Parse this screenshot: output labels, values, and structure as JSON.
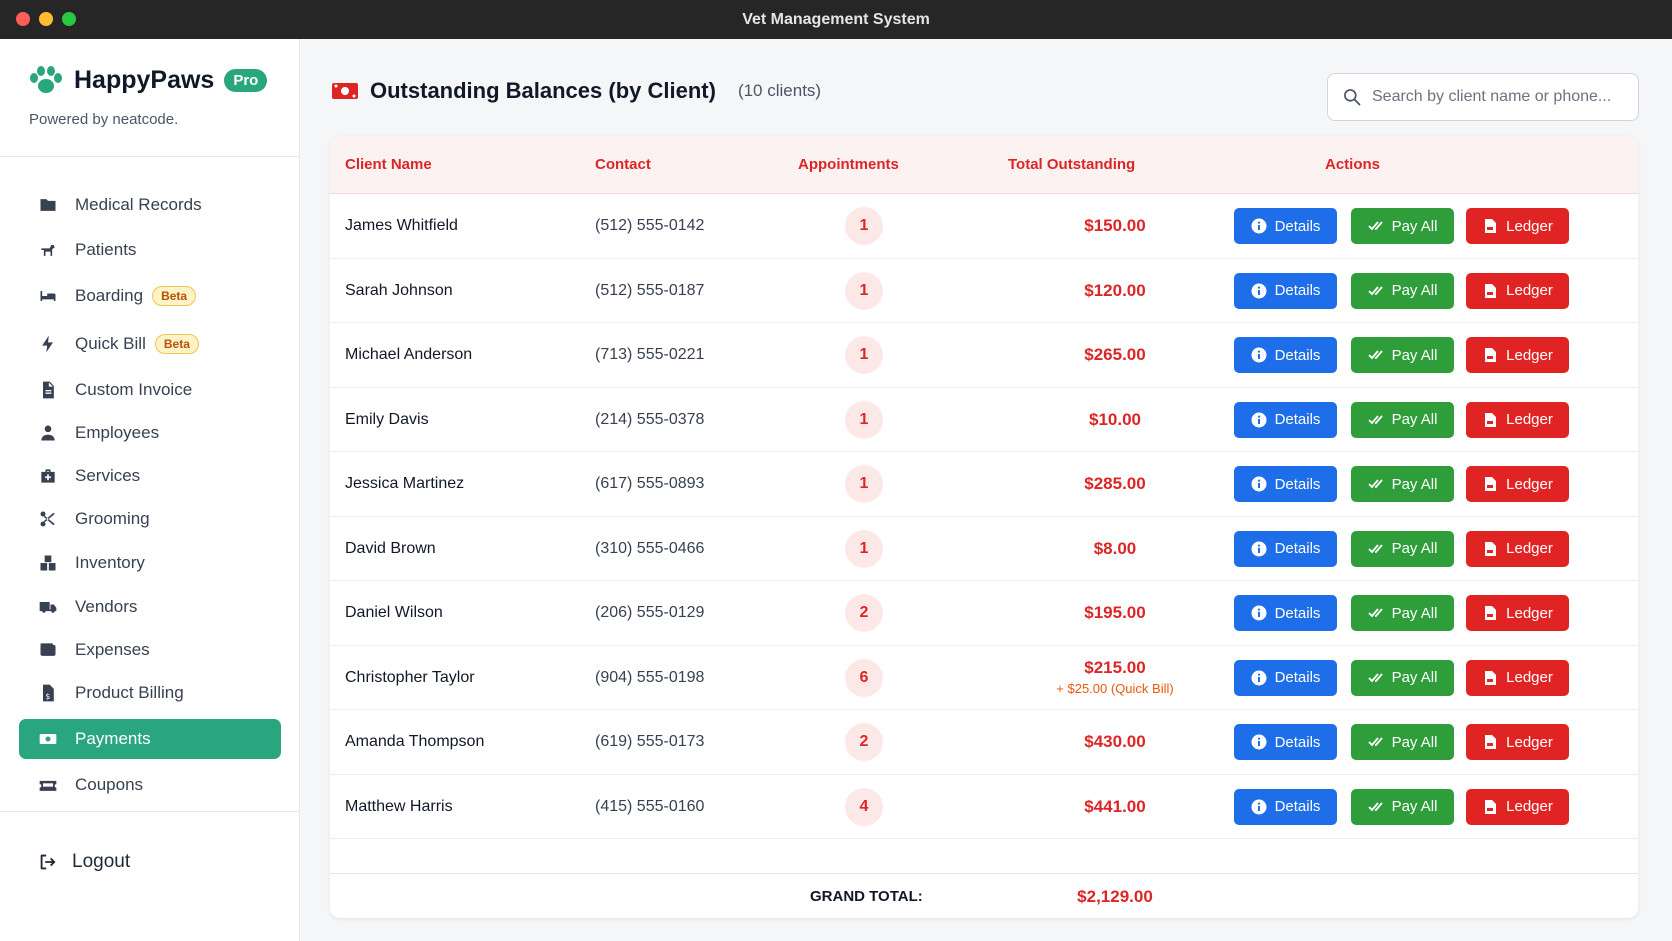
{
  "window": {
    "title": "Vet Management System"
  },
  "brand": {
    "name": "HappyPaws",
    "badge": "Pro",
    "powered_by": "Powered by neatcode."
  },
  "sidebar": {
    "items": [
      {
        "label": "Medical Records",
        "icon": "folder-icon"
      },
      {
        "label": "Patients",
        "icon": "dog-icon"
      },
      {
        "label": "Boarding",
        "icon": "bed-icon",
        "badge": "Beta"
      },
      {
        "label": "Quick Bill",
        "icon": "bolt-icon",
        "badge": "Beta"
      },
      {
        "label": "Custom Invoice",
        "icon": "file-icon"
      },
      {
        "label": "Employees",
        "icon": "user-icon"
      },
      {
        "label": "Services",
        "icon": "medkit-icon"
      },
      {
        "label": "Grooming",
        "icon": "scissors-icon"
      },
      {
        "label": "Inventory",
        "icon": "boxes-icon"
      },
      {
        "label": "Vendors",
        "icon": "truck-icon"
      },
      {
        "label": "Expenses",
        "icon": "wallet-icon"
      },
      {
        "label": "Product Billing",
        "icon": "invoice-dollar-icon"
      },
      {
        "label": "Payments",
        "icon": "money-bill-icon",
        "active": true
      },
      {
        "label": "Coupons",
        "icon": "ticket-icon"
      }
    ],
    "logout": "Logout"
  },
  "header": {
    "title": "Outstanding Balances (by Client)",
    "count": "(10 clients)"
  },
  "search": {
    "placeholder": "Search by client name or phone..."
  },
  "table": {
    "columns": [
      "Client Name",
      "Contact",
      "Appointments",
      "Total Outstanding",
      "Actions"
    ],
    "buttons": {
      "details": "Details",
      "pay_all": "Pay All",
      "ledger": "Ledger"
    },
    "rows": [
      {
        "name": "James Whitfield",
        "contact": "(512) 555-0142",
        "appointments": "1",
        "total": "$150.00"
      },
      {
        "name": "Sarah Johnson",
        "contact": "(512) 555-0187",
        "appointments": "1",
        "total": "$120.00"
      },
      {
        "name": "Michael Anderson",
        "contact": "(713) 555-0221",
        "appointments": "1",
        "total": "$265.00"
      },
      {
        "name": "Emily Davis",
        "contact": "(214) 555-0378",
        "appointments": "1",
        "total": "$10.00"
      },
      {
        "name": "Jessica Martinez",
        "contact": "(617) 555-0893",
        "appointments": "1",
        "total": "$285.00"
      },
      {
        "name": "David Brown",
        "contact": "(310) 555-0466",
        "appointments": "1",
        "total": "$8.00"
      },
      {
        "name": "Daniel Wilson",
        "contact": "(206) 555-0129",
        "appointments": "2",
        "total": "$195.00"
      },
      {
        "name": "Christopher Taylor",
        "contact": "(904) 555-0198",
        "appointments": "6",
        "total": "$215.00",
        "extra": "+ $25.00 (Quick Bill)"
      },
      {
        "name": "Amanda Thompson",
        "contact": "(619) 555-0173",
        "appointments": "2",
        "total": "$430.00"
      },
      {
        "name": "Matthew Harris",
        "contact": "(415) 555-0160",
        "appointments": "4",
        "total": "$441.00"
      }
    ],
    "grand_total_label": "GRAND TOTAL:",
    "grand_total": "$2,129.00"
  },
  "colors": {
    "accent": "#2aa67f",
    "danger": "#dc2626",
    "primary": "#1d6ee8",
    "success": "#2f9e3a"
  }
}
